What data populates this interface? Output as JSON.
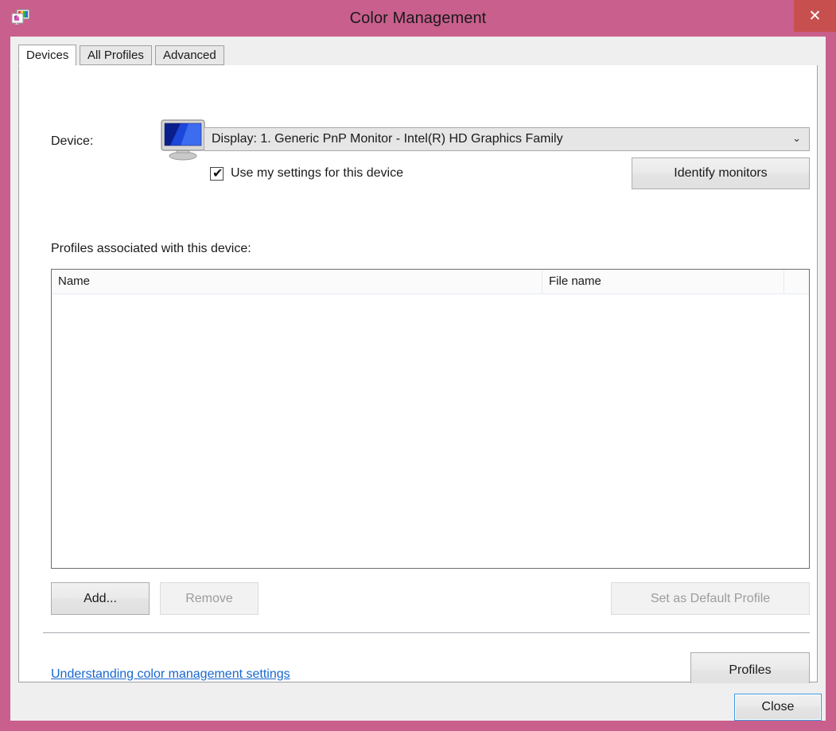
{
  "window": {
    "title": "Color Management",
    "icon": "color-management-icon",
    "close_button_glyph": "✕",
    "titlebar_color": "#c95f8d",
    "close_button_color": "#c7504f"
  },
  "tabs": [
    {
      "label": "Devices",
      "active": true
    },
    {
      "label": "All Profiles",
      "active": false
    },
    {
      "label": "Advanced",
      "active": false
    }
  ],
  "device_section": {
    "label": "Device:",
    "icon": "monitor-icon",
    "combo": {
      "value": "Display: 1. Generic PnP Monitor - Intel(R) HD Graphics Family",
      "arrow_glyph": "⌄"
    },
    "checkbox": {
      "label": "Use my settings for this device",
      "checked": true,
      "check_glyph": "✔"
    },
    "identify_button": "Identify monitors"
  },
  "profiles_section": {
    "label": "Profiles associated with this device:",
    "columns": [
      "Name",
      "File name",
      ""
    ],
    "rows": [],
    "buttons": {
      "add": "Add...",
      "remove": "Remove",
      "set_default": "Set as Default Profile"
    },
    "add_enabled": true,
    "remove_enabled": false,
    "set_default_enabled": false
  },
  "footer_section": {
    "help_link": "Understanding color management settings",
    "help_link_color": "#1767cf",
    "profiles_button": "Profiles"
  },
  "dialog_footer": {
    "close_button": "Close",
    "close_focused": true
  }
}
